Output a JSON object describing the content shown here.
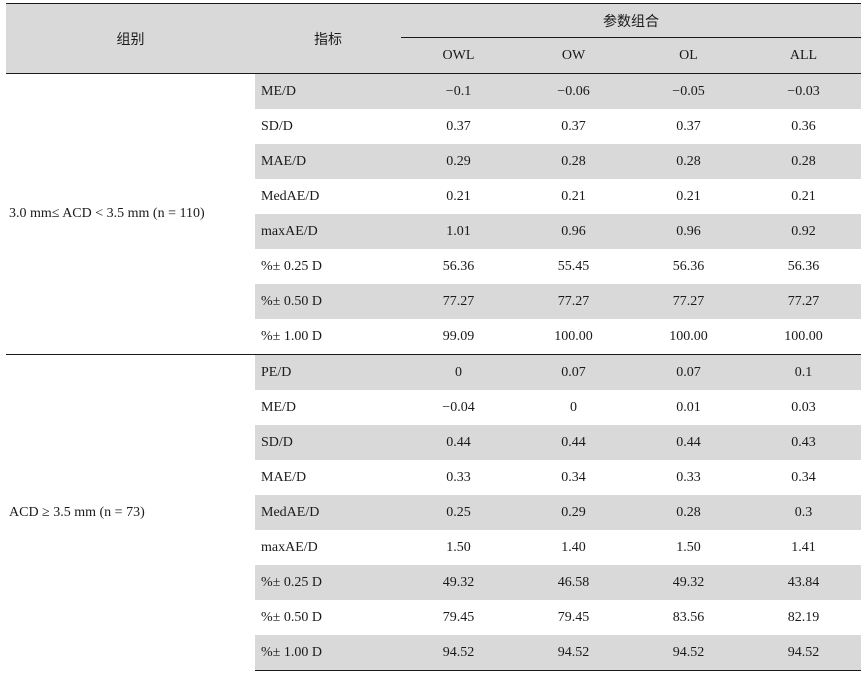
{
  "header": {
    "group_label": "组别",
    "metric_label": "指标",
    "combo_label": "参数组合",
    "columns": [
      "OWL",
      "OW",
      "OL",
      "ALL"
    ]
  },
  "sections": [
    {
      "group": "3.0 mm≤ ACD < 3.5 mm (n = 110)",
      "rows": [
        {
          "metric": "ME/D",
          "values": [
            "−0.1",
            "−0.06",
            "−0.05",
            "−0.03"
          ]
        },
        {
          "metric": "SD/D",
          "values": [
            "0.37",
            "0.37",
            "0.37",
            "0.36"
          ]
        },
        {
          "metric": "MAE/D",
          "values": [
            "0.29",
            "0.28",
            "0.28",
            "0.28"
          ]
        },
        {
          "metric": "MedAE/D",
          "values": [
            "0.21",
            "0.21",
            "0.21",
            "0.21"
          ]
        },
        {
          "metric": "maxAE/D",
          "values": [
            "1.01",
            "0.96",
            "0.96",
            "0.92"
          ]
        },
        {
          "metric": "%± 0.25 D",
          "values": [
            "56.36",
            "55.45",
            "56.36",
            "56.36"
          ]
        },
        {
          "metric": "%± 0.50 D",
          "values": [
            "77.27",
            "77.27",
            "77.27",
            "77.27"
          ]
        },
        {
          "metric": "%± 1.00 D",
          "values": [
            "99.09",
            "100.00",
            "100.00",
            "100.00"
          ]
        }
      ]
    },
    {
      "group": "ACD ≥ 3.5 mm (n = 73)",
      "rows": [
        {
          "metric": "PE/D",
          "values": [
            "0",
            "0.07",
            "0.07",
            "0.1"
          ]
        },
        {
          "metric": "ME/D",
          "values": [
            "−0.04",
            "0",
            "0.01",
            "0.03"
          ]
        },
        {
          "metric": "SD/D",
          "values": [
            "0.44",
            "0.44",
            "0.44",
            "0.43"
          ]
        },
        {
          "metric": "MAE/D",
          "values": [
            "0.33",
            "0.34",
            "0.33",
            "0.34"
          ]
        },
        {
          "metric": "MedAE/D",
          "values": [
            "0.25",
            "0.29",
            "0.28",
            "0.3"
          ]
        },
        {
          "metric": "maxAE/D",
          "values": [
            "1.50",
            "1.40",
            "1.50",
            "1.41"
          ]
        },
        {
          "metric": "%± 0.25 D",
          "values": [
            "49.32",
            "46.58",
            "49.32",
            "43.84"
          ]
        },
        {
          "metric": "%± 0.50 D",
          "values": [
            "79.45",
            "79.45",
            "83.56",
            "82.19"
          ]
        },
        {
          "metric": "%± 1.00 D",
          "values": [
            "94.52",
            "94.52",
            "94.52",
            "94.52"
          ]
        }
      ]
    }
  ]
}
